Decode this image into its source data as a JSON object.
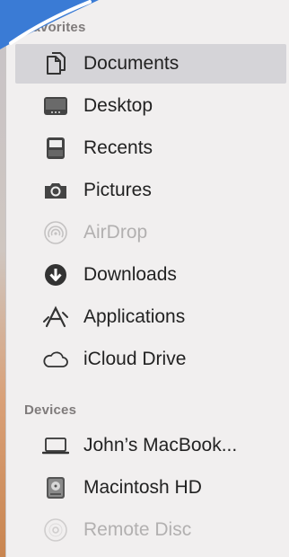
{
  "sidebar": {
    "favorites_header": "Favorites",
    "devices_header": "Devices",
    "favorites": [
      {
        "label": "Documents",
        "icon": "documents-icon",
        "selected": true
      },
      {
        "label": "Desktop",
        "icon": "desktop-icon"
      },
      {
        "label": "Recents",
        "icon": "recents-icon"
      },
      {
        "label": "Pictures",
        "icon": "camera-icon"
      },
      {
        "label": "AirDrop",
        "icon": "airdrop-icon",
        "disabled": true
      },
      {
        "label": "Downloads",
        "icon": "download-icon"
      },
      {
        "label": "Applications",
        "icon": "applications-icon"
      },
      {
        "label": "iCloud Drive",
        "icon": "cloud-icon"
      }
    ],
    "devices": [
      {
        "label": "John’s MacBook...",
        "icon": "laptop-icon"
      },
      {
        "label": "Macintosh HD",
        "icon": "hard-drive-icon"
      },
      {
        "label": "Remote Disc",
        "icon": "disc-icon",
        "disabled": true
      }
    ]
  },
  "colors": {
    "selection": "#d5d4d8",
    "accent_blue": "#3a7bd5",
    "wallpaper_orange": "#d9a077"
  }
}
